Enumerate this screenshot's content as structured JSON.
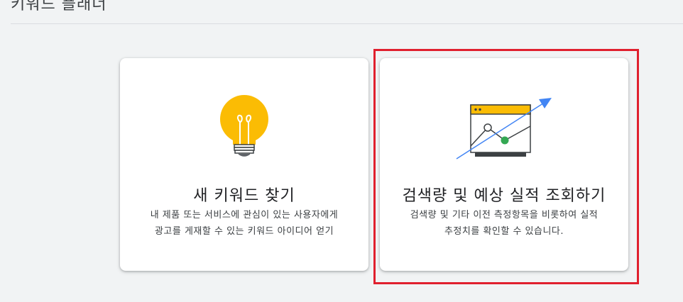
{
  "header": {
    "title": "키워드 플래너"
  },
  "cards": [
    {
      "title": "새 키워드 찾기",
      "description_line1": "내 제품 또는 서비스에 관심이 있는 사용자에게",
      "description_line2": "광고를 게재할 수 있는 키워드 아이디어 얻기",
      "icon": "lightbulb-icon"
    },
    {
      "title": "검색량 및 예상 실적 조회하기",
      "description_line1": "검색량 및 기타 이전 측정항목을 비롯하여 실적",
      "description_line2": "추정치를 확인할 수 있습니다.",
      "icon": "trend-chart-icon"
    }
  ],
  "colors": {
    "bulb": "#fbbc04",
    "arrow": "#4285f4",
    "point_green": "#34a853",
    "highlight": "#e0202e",
    "background": "#f1f3f4"
  }
}
